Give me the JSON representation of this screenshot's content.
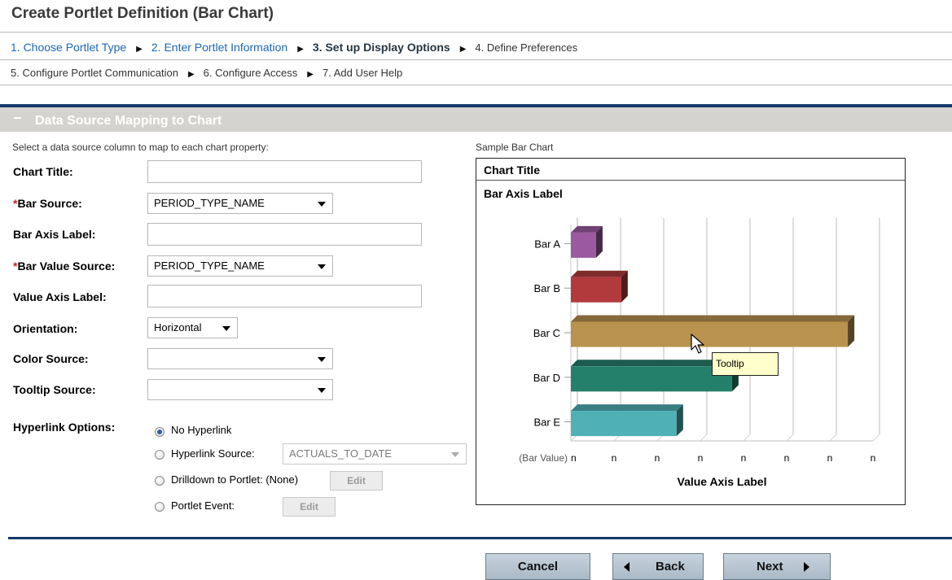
{
  "header": {
    "title": "Create Portlet Definition (Bar Chart)",
    "steps_row1": [
      {
        "label": "1. Choose Portlet Type",
        "state": "done"
      },
      {
        "label": "2. Enter Portlet Information",
        "state": "done"
      },
      {
        "label": "3. Set up Display Options",
        "state": "current"
      },
      {
        "label": "4. Define Preferences",
        "state": "todo"
      }
    ],
    "steps_row2": [
      {
        "label": "5. Configure Portlet Communication",
        "state": "todo"
      },
      {
        "label": "6. Configure Access",
        "state": "todo"
      },
      {
        "label": "7. Add User Help",
        "state": "todo"
      }
    ],
    "step_separator": "▶"
  },
  "section": {
    "collapse_symbol": "−",
    "title": "Data Source Mapping to Chart"
  },
  "form": {
    "intro": "Select a data source column to map to each chart property:",
    "required_marker": "*",
    "chart_title_label": "Chart Title:",
    "chart_title_value": "",
    "bar_source_label": "Bar Source:",
    "bar_source_value": "PERIOD_TYPE_NAME",
    "bar_axis_label_label": "Bar Axis Label:",
    "bar_axis_label_value": "",
    "bar_value_source_label": "Bar Value Source:",
    "bar_value_source_value": "PERIOD_TYPE_NAME",
    "value_axis_label_label": "Value Axis Label:",
    "value_axis_label_value": "",
    "orientation_label": "Orientation:",
    "orientation_value": "Horizontal",
    "color_source_label": "Color Source:",
    "color_source_value": "",
    "tooltip_source_label": "Tooltip Source:",
    "tooltip_source_value": "",
    "hyperlink_options_label": "Hyperlink Options:",
    "hyperlink": {
      "no_hyperlink": "No Hyperlink",
      "hyperlink_source": "Hyperlink Source:",
      "hyperlink_source_value": "ACTUALS_TO_DATE",
      "drilldown": "Drilldown to Portlet: (None)",
      "portlet_event": "Portlet Event:",
      "edit": "Edit",
      "selected": "no_hyperlink"
    }
  },
  "sample_chart": {
    "caption": "Sample Bar Chart",
    "tooltip": "Tooltip",
    "colors": {
      "Bar A": "#9b5aa0",
      "Bar B": "#b23a3c",
      "Bar C": "#b9924e",
      "Bar D": "#25806b",
      "Bar E": "#4fb1b5"
    }
  },
  "chart_data": {
    "type": "bar",
    "orientation": "horizontal",
    "title": "Chart Title",
    "ylabel": "Bar Axis Label",
    "xlabel": "Value Axis Label",
    "categories": [
      "Bar A",
      "Bar B",
      "Bar C",
      "Bar D",
      "Bar E"
    ],
    "values": [
      1,
      2,
      11,
      6.4,
      4.2
    ],
    "xlim": [
      0,
      12
    ],
    "value_tick_prefix": "(Bar Value)",
    "tick_labels": [
      "n",
      "n",
      "n",
      "n",
      "n",
      "n",
      "n",
      "n"
    ],
    "grid": true
  },
  "footer": {
    "cancel": "Cancel",
    "back": "Back",
    "next": "Next"
  }
}
